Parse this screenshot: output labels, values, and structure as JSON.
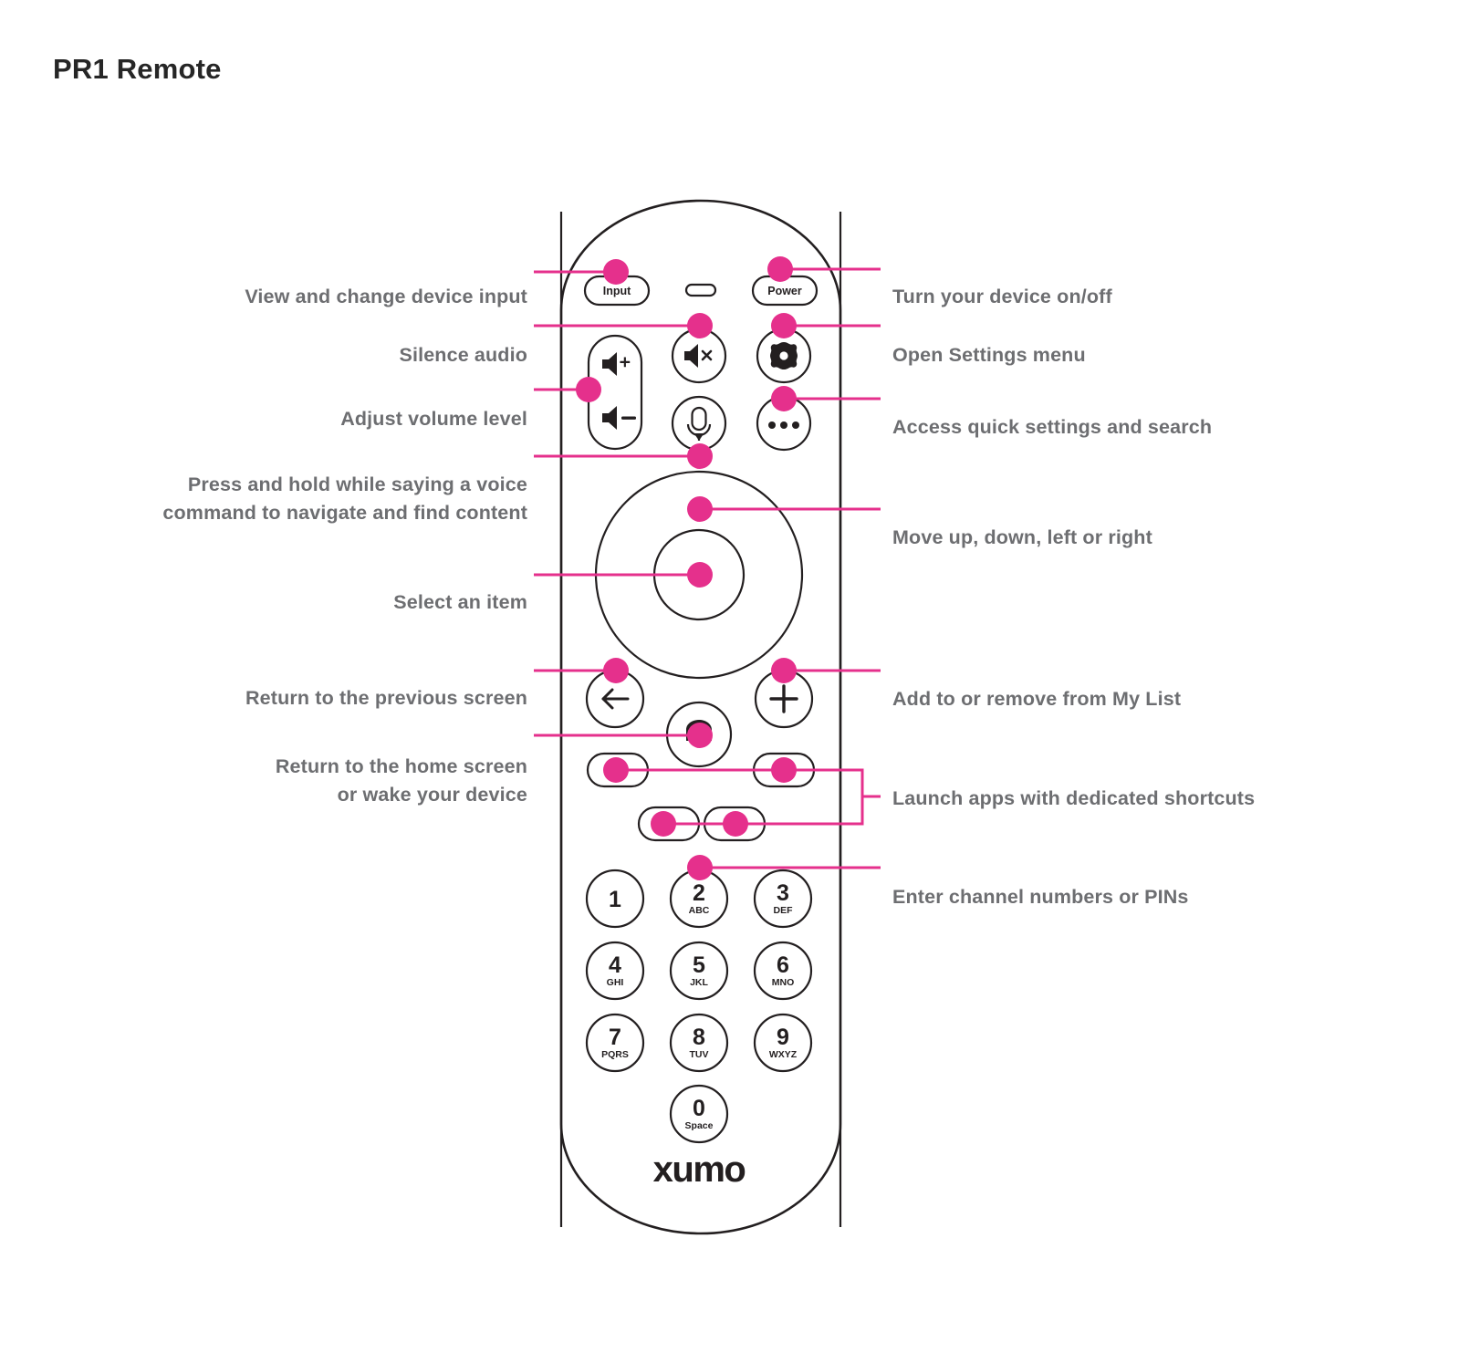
{
  "page": {
    "title": "PR1 Remote",
    "brand_logo": "xumo",
    "title_color": "#262626",
    "label_color": "#6d6e71",
    "accent_color": "#e5308c",
    "device_outline_color": "#231f20",
    "background_color": "#ffffff"
  },
  "callouts": {
    "left": [
      {
        "id": "input",
        "text": "View and change device input"
      },
      {
        "id": "mute",
        "text": "Silence audio"
      },
      {
        "id": "volume",
        "text": "Adjust volume level"
      },
      {
        "id": "voice",
        "text": "Press and hold while saying a voice\ncommand to navigate and find content"
      },
      {
        "id": "select",
        "text": "Select an item"
      },
      {
        "id": "back",
        "text": "Return to the previous screen"
      },
      {
        "id": "home",
        "text": "Return to the home screen\nor wake your device"
      }
    ],
    "right": [
      {
        "id": "power",
        "text": "Turn your device on/off"
      },
      {
        "id": "settings",
        "text": "Open Settings menu"
      },
      {
        "id": "quick",
        "text": "Access quick settings and search"
      },
      {
        "id": "dpad",
        "text": "Move up, down, left or right"
      },
      {
        "id": "mylist",
        "text": "Add to or remove from My List"
      },
      {
        "id": "apps",
        "text": "Launch apps with dedicated shortcuts"
      },
      {
        "id": "numbers",
        "text": "Enter channel numbers or PINs"
      }
    ]
  },
  "remote": {
    "buttons": {
      "input_label": "Input",
      "power_label": "Power",
      "ir_window": "",
      "volume_up": "volume-up-icon",
      "volume_down": "volume-down-icon",
      "mute": "mute-icon",
      "voice": "microphone-icon",
      "settings": "gear-icon",
      "quick_settings": "ellipsis-icon",
      "dpad": "dpad-ring",
      "ok": "select-button",
      "back": "back-arrow-icon",
      "home": "home-icon",
      "my_list": "plus-icon",
      "app_shortcut_1": "app-shortcut-button",
      "app_shortcut_2": "app-shortcut-button",
      "app_shortcut_3": "app-shortcut-button",
      "app_shortcut_4": "app-shortcut-button"
    },
    "keypad": [
      {
        "digit": "1",
        "letters": ""
      },
      {
        "digit": "2",
        "letters": "ABC"
      },
      {
        "digit": "3",
        "letters": "DEF"
      },
      {
        "digit": "4",
        "letters": "GHI"
      },
      {
        "digit": "5",
        "letters": "JKL"
      },
      {
        "digit": "6",
        "letters": "MNO"
      },
      {
        "digit": "7",
        "letters": "PQRS"
      },
      {
        "digit": "8",
        "letters": "TUV"
      },
      {
        "digit": "9",
        "letters": "WXYZ"
      },
      {
        "digit": "0",
        "letters": "Space"
      }
    ]
  }
}
